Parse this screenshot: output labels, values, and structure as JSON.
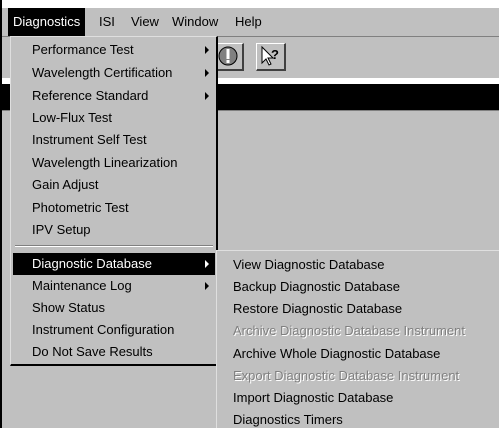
{
  "menubar": {
    "items": [
      {
        "label": "Diagnostics"
      },
      {
        "label": "ISI"
      },
      {
        "label": "View"
      },
      {
        "label": "Window"
      },
      {
        "label": "Help"
      }
    ]
  },
  "toolbar": {
    "icons": [
      "stop-icon",
      "context-help-icon"
    ],
    "help_glyph": "?"
  },
  "menu": {
    "items": [
      {
        "label": "Performance Test",
        "submenu": true
      },
      {
        "label": "Wavelength Certification",
        "submenu": true
      },
      {
        "label": "Reference Standard",
        "submenu": true
      },
      {
        "label": "Low-Flux Test"
      },
      {
        "label": "Instrument Self Test"
      },
      {
        "label": "Wavelength Linearization"
      },
      {
        "label": "Gain Adjust"
      },
      {
        "label": "Photometric Test"
      },
      {
        "label": "IPV Setup"
      },
      {
        "label": "Diagnostic Database",
        "submenu": true,
        "highlighted": true
      },
      {
        "label": "Maintenance Log",
        "submenu": true
      },
      {
        "label": "Show Status"
      },
      {
        "label": "Instrument Configuration"
      },
      {
        "label": "Do Not Save Results"
      }
    ]
  },
  "submenu": {
    "items": [
      {
        "label": "View Diagnostic Database",
        "enabled": true
      },
      {
        "label": "Backup Diagnostic Database",
        "enabled": true
      },
      {
        "label": "Restore Diagnostic Database",
        "enabled": true
      },
      {
        "label": "Archive Diagnostic Database Instrument",
        "enabled": false
      },
      {
        "label": "Archive Whole Diagnostic Database",
        "enabled": true
      },
      {
        "label": "Export Diagnostic Database Instrument",
        "enabled": false
      },
      {
        "label": "Import Diagnostic Database",
        "enabled": true
      },
      {
        "label": "Diagnostics Timers",
        "enabled": true
      }
    ]
  },
  "colors": {
    "face": "#c0c0c0",
    "highlight": "#000000",
    "highlight_text": "#ffffff",
    "disabled": "#808080"
  }
}
